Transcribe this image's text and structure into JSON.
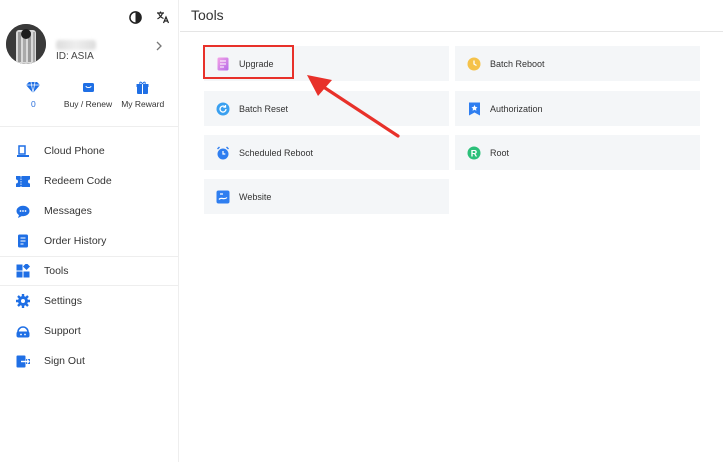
{
  "header": {
    "title": "Tools"
  },
  "profile": {
    "id_text": "ID: ASIA"
  },
  "stats": [
    {
      "label": "0",
      "kind": "number"
    },
    {
      "label": "Buy / Renew"
    },
    {
      "label": "My Reward"
    }
  ],
  "nav": [
    {
      "label": "Cloud Phone"
    },
    {
      "label": "Redeem Code"
    },
    {
      "label": "Messages"
    },
    {
      "label": "Order History"
    },
    {
      "label": "Tools"
    },
    {
      "label": "Settings"
    },
    {
      "label": "Support"
    },
    {
      "label": "Sign Out"
    }
  ],
  "tools": [
    {
      "label": "Upgrade"
    },
    {
      "label": "Batch Reboot"
    },
    {
      "label": "Batch Reset"
    },
    {
      "label": "Authorization"
    },
    {
      "label": "Scheduled Reboot"
    },
    {
      "label": "Root"
    },
    {
      "label": "Website"
    }
  ],
  "colors": {
    "accent": "#1f6fe5",
    "highlight": "#e8312a",
    "tile_bg": "#f4f6f8"
  }
}
